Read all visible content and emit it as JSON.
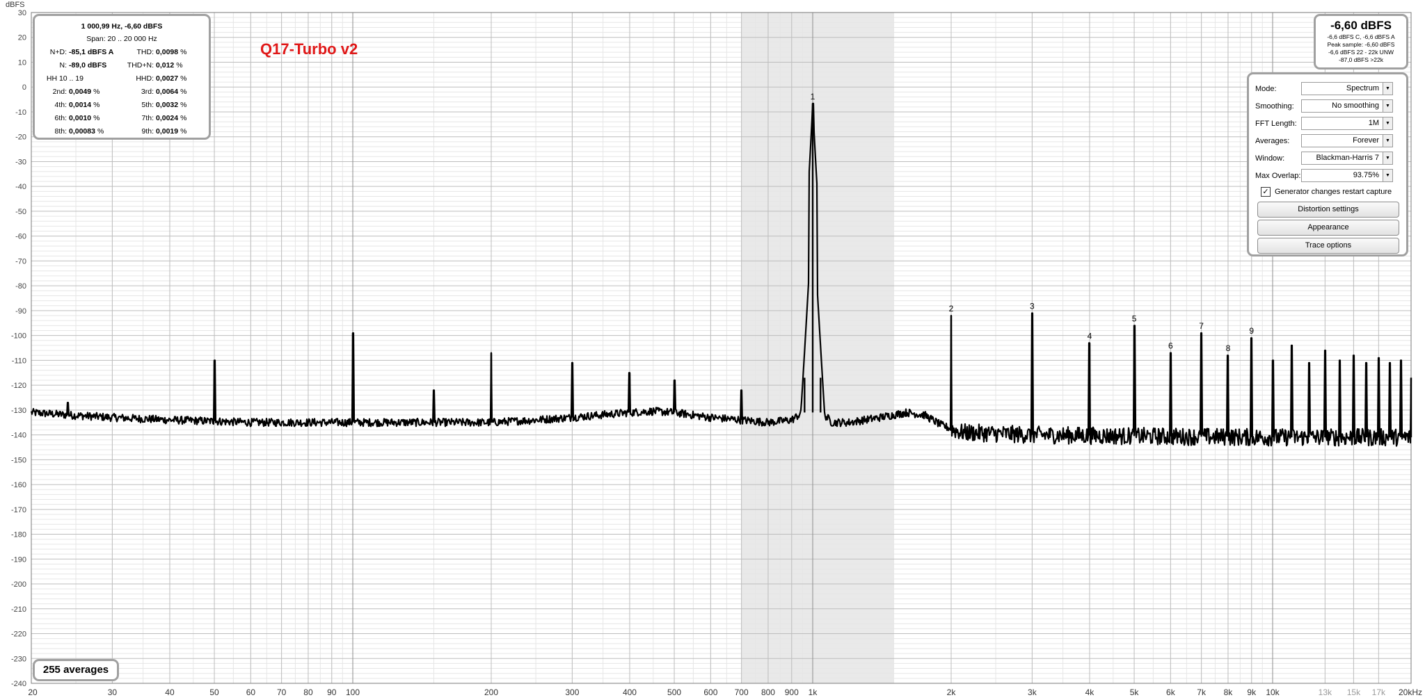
{
  "app": {
    "y_unit_label": "dBFS",
    "title": "Q17-Turbo v2",
    "averages_label": "255 averages"
  },
  "stats": {
    "header": "1 000,99 Hz, -6,60 dBFS",
    "span": "Span: 20 .. 20 000 Hz",
    "rows": [
      {
        "l1": "N+D:",
        "v1": "-85,1 dBFS A",
        "u1": "",
        "l2": "THD:",
        "v2": "0,0098",
        "u2": "%"
      },
      {
        "l1": "N:",
        "v1": "-89,0 dBFS",
        "u1": "",
        "l2": "THD+N:",
        "v2": "0,012",
        "u2": "%"
      },
      {
        "l1": "HH 10 .. 19",
        "v1": "",
        "u1": "",
        "l2": "HHD:",
        "v2": "0,0027",
        "u2": "%"
      },
      {
        "l1": "2nd:",
        "v1": "0,0049",
        "u1": "%",
        "l2": "3rd:",
        "v2": "0,0064",
        "u2": "%"
      },
      {
        "l1": "4th:",
        "v1": "0,0014",
        "u1": "%",
        "l2": "5th:",
        "v2": "0,0032",
        "u2": "%"
      },
      {
        "l1": "6th:",
        "v1": "0,0010",
        "u1": "%",
        "l2": "7th:",
        "v2": "0,0024",
        "u2": "%"
      },
      {
        "l1": "8th:",
        "v1": "0,00083",
        "u1": "%",
        "l2": "9th:",
        "v2": "0,0019",
        "u2": "%"
      }
    ]
  },
  "level": {
    "main": "-6,60 dBFS",
    "lines": [
      "-6,6 dBFS C, -6,6 dBFS A",
      "Peak sample: -6,60 dBFS",
      "-6,6 dBFS 22 - 22k UNW",
      "-87,0 dBFS >22k"
    ]
  },
  "controls": {
    "mode_label": "Mode:",
    "mode_value": "Spectrum",
    "smoothing_label": "Smoothing:",
    "smoothing_value": "No  smoothing",
    "fft_label": "FFT Length:",
    "fft_value": "1M",
    "averages_label": "Averages:",
    "averages_value": "Forever",
    "window_label": "Window:",
    "window_value": "Blackman-Harris 7",
    "overlap_label": "Max Overlap:",
    "overlap_value": "93.75%",
    "generator_label": "Generator changes restart capture",
    "generator_checked": true,
    "distortion_button": "Distortion settings",
    "appearance_button": "Appearance",
    "trace_button": "Trace options"
  },
  "icons": {
    "dropdown": "chevron-down-icon",
    "check": "checkmark-icon"
  },
  "colors": {
    "title": "#e01818",
    "trace": "#000000",
    "grid_major": "#bdbdbd",
    "grid_minor": "#e6e6e6",
    "shade": "#e9e9e9",
    "panel_border": "#a0a0a0"
  },
  "chart_data": {
    "type": "line",
    "ylabel": "dBFS",
    "ylim": [
      -240,
      30
    ],
    "xlim": [
      20,
      20000
    ],
    "x_scale": "log",
    "y_ticks": [
      30,
      20,
      10,
      0,
      -10,
      -20,
      -30,
      -40,
      -50,
      -60,
      -70,
      -80,
      -90,
      -100,
      -110,
      -120,
      -130,
      -140,
      -150,
      -160,
      -170,
      -180,
      -190,
      -200,
      -210,
      -220,
      -230,
      -240
    ],
    "x_ticks": [
      {
        "v": 20,
        "label": "20"
      },
      {
        "v": 30,
        "label": "30"
      },
      {
        "v": 40,
        "label": "40"
      },
      {
        "v": 50,
        "label": "50"
      },
      {
        "v": 60,
        "label": "60"
      },
      {
        "v": 70,
        "label": "70"
      },
      {
        "v": 80,
        "label": "80"
      },
      {
        "v": 90,
        "label": "90"
      },
      {
        "v": 100,
        "label": "100"
      },
      {
        "v": 200,
        "label": "200"
      },
      {
        "v": 300,
        "label": "300"
      },
      {
        "v": 400,
        "label": "400"
      },
      {
        "v": 500,
        "label": "500"
      },
      {
        "v": 600,
        "label": "600"
      },
      {
        "v": 700,
        "label": "700"
      },
      {
        "v": 800,
        "label": "800"
      },
      {
        "v": 900,
        "label": "900"
      },
      {
        "v": 1000,
        "label": "1k"
      },
      {
        "v": 2000,
        "label": "2k"
      },
      {
        "v": 3000,
        "label": "3k"
      },
      {
        "v": 4000,
        "label": "4k"
      },
      {
        "v": 5000,
        "label": "5k"
      },
      {
        "v": 6000,
        "label": "6k"
      },
      {
        "v": 7000,
        "label": "7k"
      },
      {
        "v": 8000,
        "label": "8k"
      },
      {
        "v": 9000,
        "label": "9k"
      },
      {
        "v": 10000,
        "label": "10k"
      },
      {
        "v": 13000,
        "label": "13k"
      },
      {
        "v": 15000,
        "label": "15k"
      },
      {
        "v": 17000,
        "label": "17k"
      },
      {
        "v": 20000,
        "label": "20kHz"
      }
    ],
    "shaded_band": [
      700,
      1500
    ],
    "noise_floor": [
      [
        20,
        -131
      ],
      [
        24,
        -132
      ],
      [
        30,
        -133
      ],
      [
        40,
        -134
      ],
      [
        50,
        -134.5
      ],
      [
        60,
        -135
      ],
      [
        80,
        -135
      ],
      [
        100,
        -135
      ],
      [
        150,
        -135
      ],
      [
        200,
        -135
      ],
      [
        250,
        -134
      ],
      [
        300,
        -133
      ],
      [
        400,
        -131
      ],
      [
        450,
        -130.5
      ],
      [
        500,
        -131
      ],
      [
        600,
        -133
      ],
      [
        700,
        -134
      ],
      [
        800,
        -135
      ],
      [
        900,
        -134
      ],
      [
        950,
        -131
      ],
      [
        1050,
        -131
      ],
      [
        1100,
        -135
      ],
      [
        1200,
        -135
      ],
      [
        1400,
        -133
      ],
      [
        1600,
        -131
      ],
      [
        1750,
        -132
      ],
      [
        1900,
        -136
      ],
      [
        2100,
        -139
      ],
      [
        3000,
        -140
      ],
      [
        5000,
        -140.5
      ],
      [
        10000,
        -141
      ],
      [
        20000,
        -141
      ]
    ],
    "peaks": [
      {
        "f": 24,
        "db": -127
      },
      {
        "f": 50,
        "db": -110
      },
      {
        "f": 100,
        "db": -99
      },
      {
        "f": 150,
        "db": -122
      },
      {
        "f": 200,
        "db": -107
      },
      {
        "f": 300,
        "db": -111
      },
      {
        "f": 400,
        "db": -115
      },
      {
        "f": 500,
        "db": -118
      },
      {
        "f": 700,
        "db": -122
      },
      {
        "f": 960,
        "db": -117
      },
      {
        "f": 1000,
        "db": -6.6
      },
      {
        "f": 1040,
        "db": -117
      },
      {
        "f": 2000,
        "db": -92
      },
      {
        "f": 3000,
        "db": -91
      },
      {
        "f": 4000,
        "db": -103
      },
      {
        "f": 5000,
        "db": -96
      },
      {
        "f": 6000,
        "db": -107
      },
      {
        "f": 7000,
        "db": -99
      },
      {
        "f": 8000,
        "db": -108
      },
      {
        "f": 9000,
        "db": -101
      },
      {
        "f": 10000,
        "db": -110
      },
      {
        "f": 11000,
        "db": -104
      },
      {
        "f": 12000,
        "db": -111
      },
      {
        "f": 13000,
        "db": -106
      },
      {
        "f": 14000,
        "db": -110
      },
      {
        "f": 15000,
        "db": -108
      },
      {
        "f": 16000,
        "db": -111
      },
      {
        "f": 17000,
        "db": -109
      },
      {
        "f": 18000,
        "db": -111
      },
      {
        "f": 19000,
        "db": -110
      },
      {
        "f": 20000,
        "db": -117
      }
    ],
    "harmonic_markers": [
      {
        "label": "1",
        "f": 1000,
        "db": -6.6
      },
      {
        "label": "2",
        "f": 2000,
        "db": -92
      },
      {
        "label": "3",
        "f": 3000,
        "db": -91
      },
      {
        "label": "4",
        "f": 4000,
        "db": -103
      },
      {
        "label": "5",
        "f": 5000,
        "db": -96
      },
      {
        "label": "6",
        "f": 6000,
        "db": -107
      },
      {
        "label": "7",
        "f": 7000,
        "db": -99
      },
      {
        "label": "8",
        "f": 8000,
        "db": -108
      },
      {
        "label": "9",
        "f": 9000,
        "db": -101
      }
    ]
  }
}
